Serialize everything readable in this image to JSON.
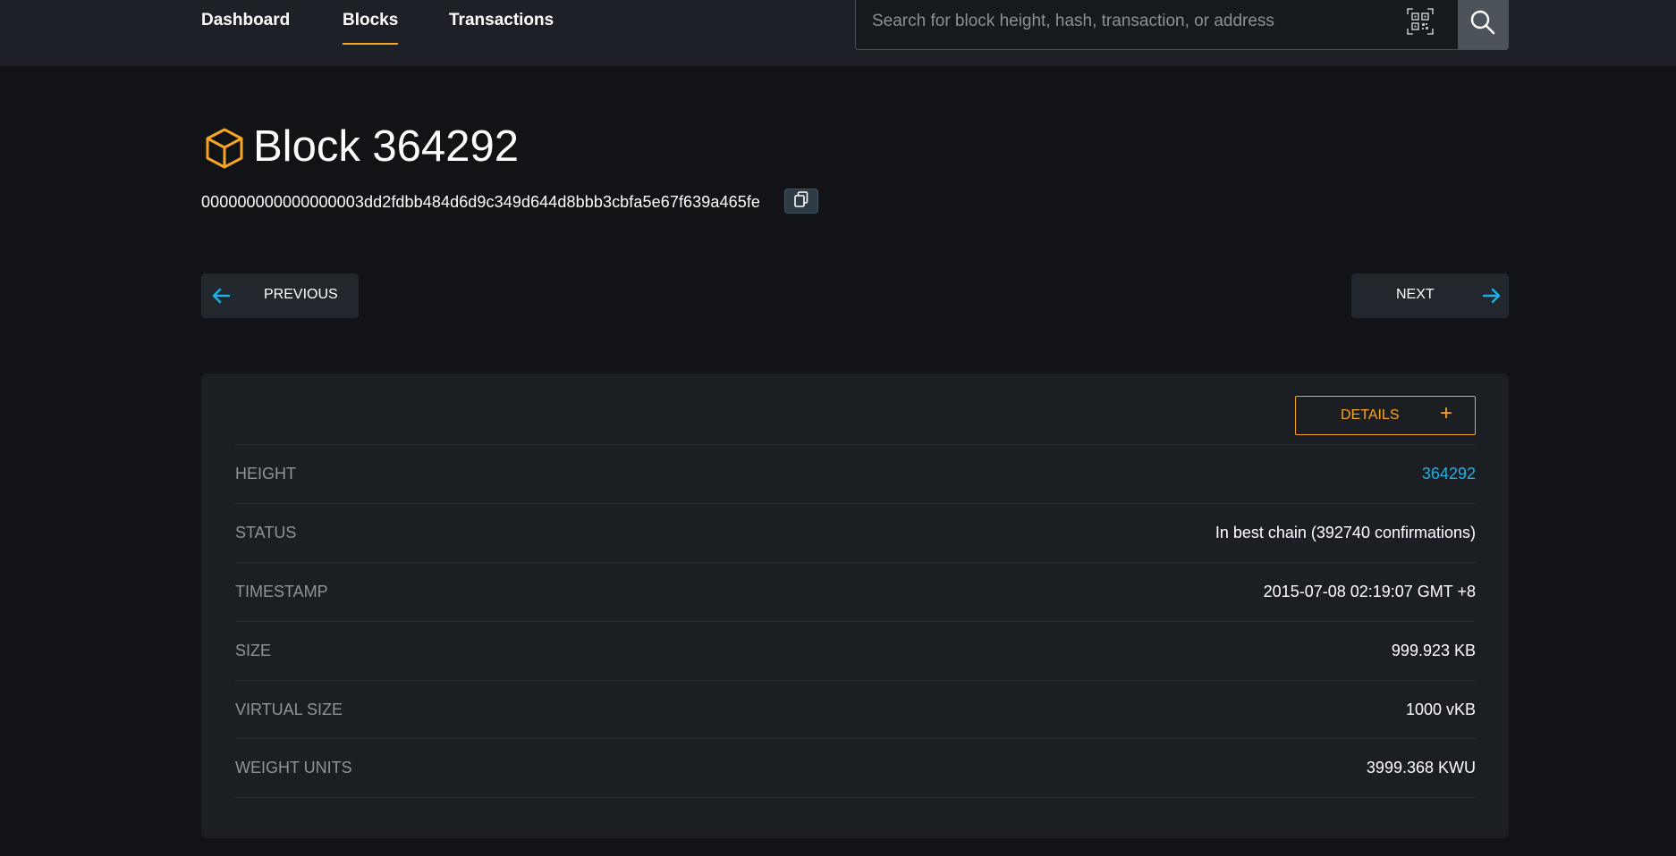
{
  "nav": {
    "items": [
      {
        "label": "Dashboard"
      },
      {
        "label": "Blocks"
      },
      {
        "label": "Transactions"
      }
    ],
    "active": "Blocks"
  },
  "search": {
    "placeholder": "Search for block height, hash, transaction, or address",
    "value": ""
  },
  "icons": {
    "block": "cube-icon",
    "copy": "copy-icon",
    "qr": "qr-code-icon",
    "search": "search-icon",
    "prev": "arrow-left-icon",
    "next": "arrow-right-icon",
    "expand": "plus-icon"
  },
  "colors": {
    "accent": "#f7a623",
    "link": "#1fb0e5",
    "background": "#111316",
    "card": "#1b1e23"
  },
  "block": {
    "title": "Block 364292",
    "hash": "000000000000000003dd2fdbb484d6d9c349d644d8bbb3cbfa5e67f639a465fe"
  },
  "pager": {
    "previous": "PREVIOUS",
    "next": "NEXT"
  },
  "details": {
    "button_label": "DETAILS",
    "button_symbol": "+",
    "rows": [
      {
        "label": "HEIGHT",
        "value": "364292"
      },
      {
        "label": "STATUS",
        "value": "In best chain (392740 confirmations)"
      },
      {
        "label": "TIMESTAMP",
        "value": "2015-07-08 02:19:07 GMT +8"
      },
      {
        "label": "SIZE",
        "value": "999.923 KB"
      },
      {
        "label": "VIRTUAL SIZE",
        "value": "1000 vKB"
      },
      {
        "label": "WEIGHT UNITS",
        "value": "3999.368 KWU"
      }
    ]
  }
}
